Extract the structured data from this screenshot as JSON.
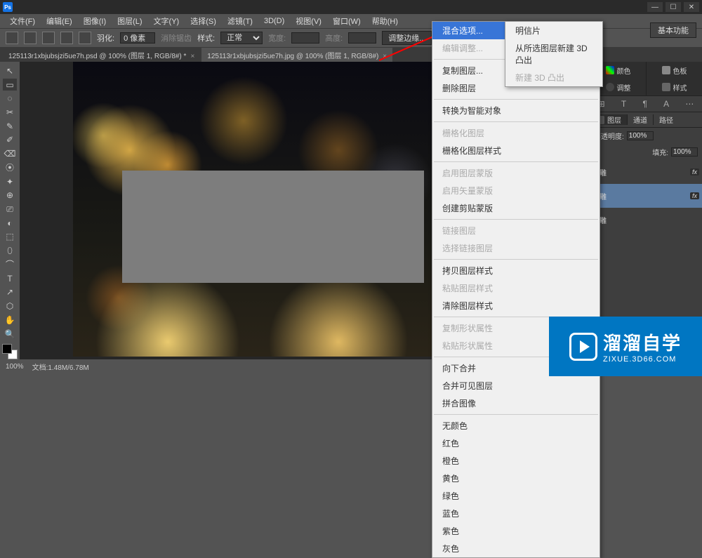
{
  "app": {
    "logo": "Ps"
  },
  "menus": [
    "文件(F)",
    "编辑(E)",
    "图像(I)",
    "图层(L)",
    "文字(Y)",
    "选择(S)",
    "滤镜(T)",
    "3D(D)",
    "视图(V)",
    "窗口(W)",
    "帮助(H)"
  ],
  "options": {
    "feather_label": "羽化:",
    "feather_value": "0 像素",
    "antialias": "消除锯齿",
    "style_label": "样式:",
    "style_value": "正常",
    "width_label": "宽度:",
    "height_label": "高度:",
    "refine": "调整边缘..."
  },
  "workspace_label": "基本功能",
  "tabs": [
    {
      "label": "125113r1xbjubsjzi5ue7h.psd @ 100% (图层 1, RGB/8#) *",
      "close": "×"
    },
    {
      "label": "125113r1xbjubsjzi5ue7h.jpg @ 100% (图层 1, RGB/8#)",
      "close": "×"
    }
  ],
  "tools": [
    "↖",
    "▭",
    "◌",
    "✂",
    "✎",
    "✐",
    "⌫",
    "⦿",
    "✦",
    "⊕",
    "⎚",
    "◐",
    "⬚",
    "⬯",
    "⌒",
    "T",
    "↗",
    "⬡",
    "✋",
    "🔍"
  ],
  "context_menu": {
    "c0": "混合选项...",
    "c1": "编辑调整...",
    "c2": "复制图层...",
    "c3": "删除图层",
    "c4": "转换为智能对象",
    "c5": "栅格化图层",
    "c6": "栅格化图层样式",
    "c7": "启用图层蒙版",
    "c8": "启用矢量蒙版",
    "c9": "创建剪贴蒙版",
    "c10": "链接图层",
    "c11": "选择链接图层",
    "c12": "拷贝图层样式",
    "c13": "粘贴图层样式",
    "c14": "清除图层样式",
    "c15": "复制形状属性",
    "c16": "粘贴形状属性",
    "c17": "向下合并",
    "c18": "合并可见图层",
    "c19": "拼合图像",
    "c20": "无颜色",
    "c21": "红色",
    "c22": "橙色",
    "c23": "黄色",
    "c24": "绿色",
    "c25": "蓝色",
    "c26": "紫色",
    "c27": "灰色"
  },
  "submenu": {
    "s0": "明信片",
    "s1": "从所选图层新建 3D 凸出",
    "s2": "新建 3D 凸出"
  },
  "right": {
    "color_tab": "颜色",
    "swatch_tab": "色板",
    "adjust_tab": "调整",
    "style_tab": "样式",
    "layers_tab": "图层",
    "channels_tab": "通道",
    "paths_tab": "路径",
    "opacity_label": "不透明度:",
    "opacity_value": "100%",
    "fill_label": "填充:",
    "fill_value": "100%",
    "layer1": "浮雕",
    "layer2": "浮雕",
    "fx": "fx"
  },
  "status": {
    "zoom": "100%",
    "doc": "文档:1.48M/6.78M"
  },
  "watermark": {
    "big": "溜溜自学",
    "small": "ZIXUE.3D66.COM"
  }
}
